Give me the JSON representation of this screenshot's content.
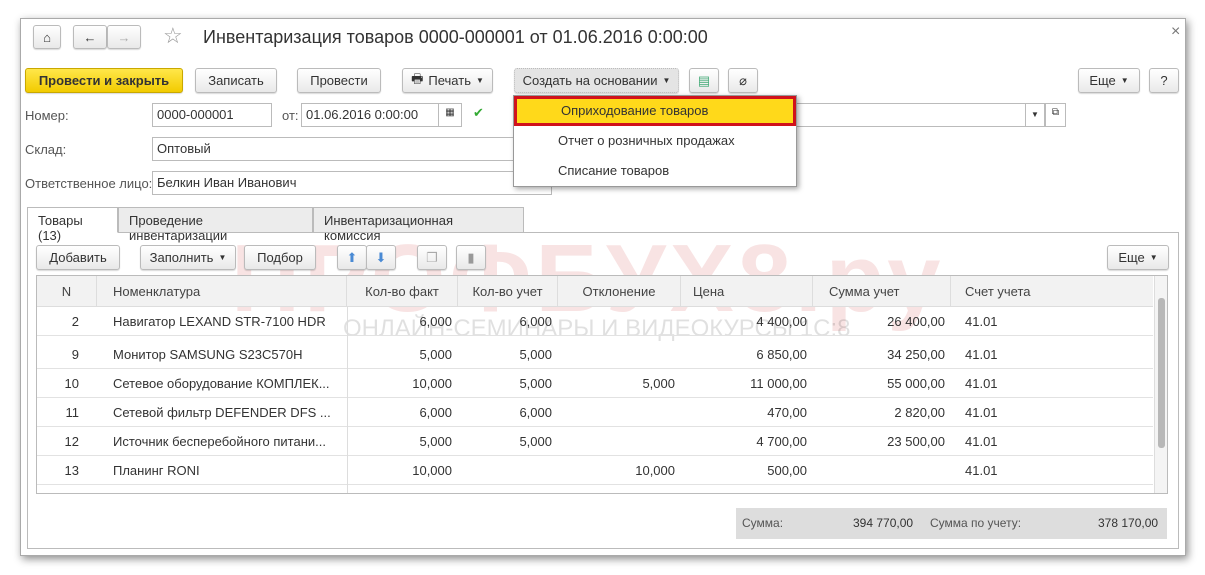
{
  "window": {
    "title": "Инвентаризация товаров 0000-000001 от 01.06.2016 0:00:00",
    "close": "×"
  },
  "toolbar": {
    "post_close": "Провести и закрыть",
    "save": "Записать",
    "post": "Провести",
    "print": "Печать",
    "create_based": "Создать на основании",
    "more": "Еще",
    "help": "?"
  },
  "dropdown": {
    "items": [
      "Оприходование товаров",
      "Отчет о розничных продажах",
      "Списание товаров"
    ]
  },
  "form": {
    "number_label": "Номер:",
    "number": "0000-000001",
    "date_label": "от:",
    "date": "01.06.2016  0:00:00",
    "warehouse_label": "Склад:",
    "warehouse": "Оптовый",
    "responsible_label": "Ответственное лицо:",
    "responsible": "Белкин Иван Иванович"
  },
  "tabs": [
    "Товары (13)",
    "Проведение инвентаризации",
    "Инвентаризационная комиссия"
  ],
  "table_toolbar": {
    "add": "Добавить",
    "fill": "Заполнить",
    "pick": "Подбор",
    "more": "Еще"
  },
  "table": {
    "headers": [
      "N",
      "Номенклатура",
      "Кол-во факт",
      "Кол-во учет",
      "Отклонение",
      "Цена",
      "Сумма учет",
      "Счет учета"
    ],
    "rows": [
      [
        "2",
        "Навигатор LEXAND STR-7100 HDR",
        "6,000",
        "6,000",
        "",
        "4 400,00",
        "26 400,00",
        "41.01"
      ],
      [
        "9",
        "Монитор  SAMSUNG S23C570H",
        "5,000",
        "5,000",
        "",
        "6 850,00",
        "34 250,00",
        "41.01"
      ],
      [
        "10",
        "Сетевое оборудование КОМПЛЕК...",
        "10,000",
        "5,000",
        "5,000",
        "11 000,00",
        "55 000,00",
        "41.01"
      ],
      [
        "11",
        "Сетевой фильтр DEFENDER DFS ...",
        "6,000",
        "6,000",
        "",
        "470,00",
        "2 820,00",
        "41.01"
      ],
      [
        "12",
        "Источник бесперебойного  питани...",
        "5,000",
        "5,000",
        "",
        "4 700,00",
        "23 500,00",
        "41.01"
      ],
      [
        "13",
        "Планинг RONI",
        "10,000",
        "",
        "10,000",
        "500,00",
        "",
        "41.01"
      ]
    ]
  },
  "totals": {
    "sum_label": "Сумма:",
    "sum": "394 770,00",
    "acc_label": "Сумма по учету:",
    "acc": "378 170,00"
  },
  "watermark": {
    "brand": "ПРОФБУХ8.ру",
    "tagline": "ОНЛАЙН-СЕМИНАРЫ И ВИДЕОКУРСЫ 1С:8"
  }
}
